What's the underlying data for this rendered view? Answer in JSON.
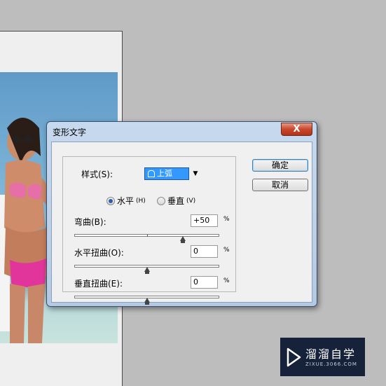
{
  "dialog": {
    "title": "变形文字",
    "close_label": "X"
  },
  "style": {
    "label": "样式(S):",
    "value": "上弧",
    "icon": "arc-upper-icon"
  },
  "orientation": {
    "horizontal_label": "水平",
    "horizontal_key": "(H)",
    "vertical_label": "垂直",
    "vertical_key": "(V)",
    "selected": "horizontal"
  },
  "bend": {
    "label": "弯曲(B):",
    "value": "+50",
    "unit": "%",
    "level_percent": 50
  },
  "h_distortion": {
    "label": "水平扭曲(O):",
    "value": "0",
    "unit": "%",
    "level_percent": 0
  },
  "v_distortion": {
    "label": "垂直扭曲(E):",
    "value": "0",
    "unit": "%",
    "level_percent": 0
  },
  "buttons": {
    "ok": "确定",
    "cancel": "取消"
  },
  "watermark": {
    "main": "溜溜自学",
    "sub": "ZIXUE.3066.COM"
  }
}
